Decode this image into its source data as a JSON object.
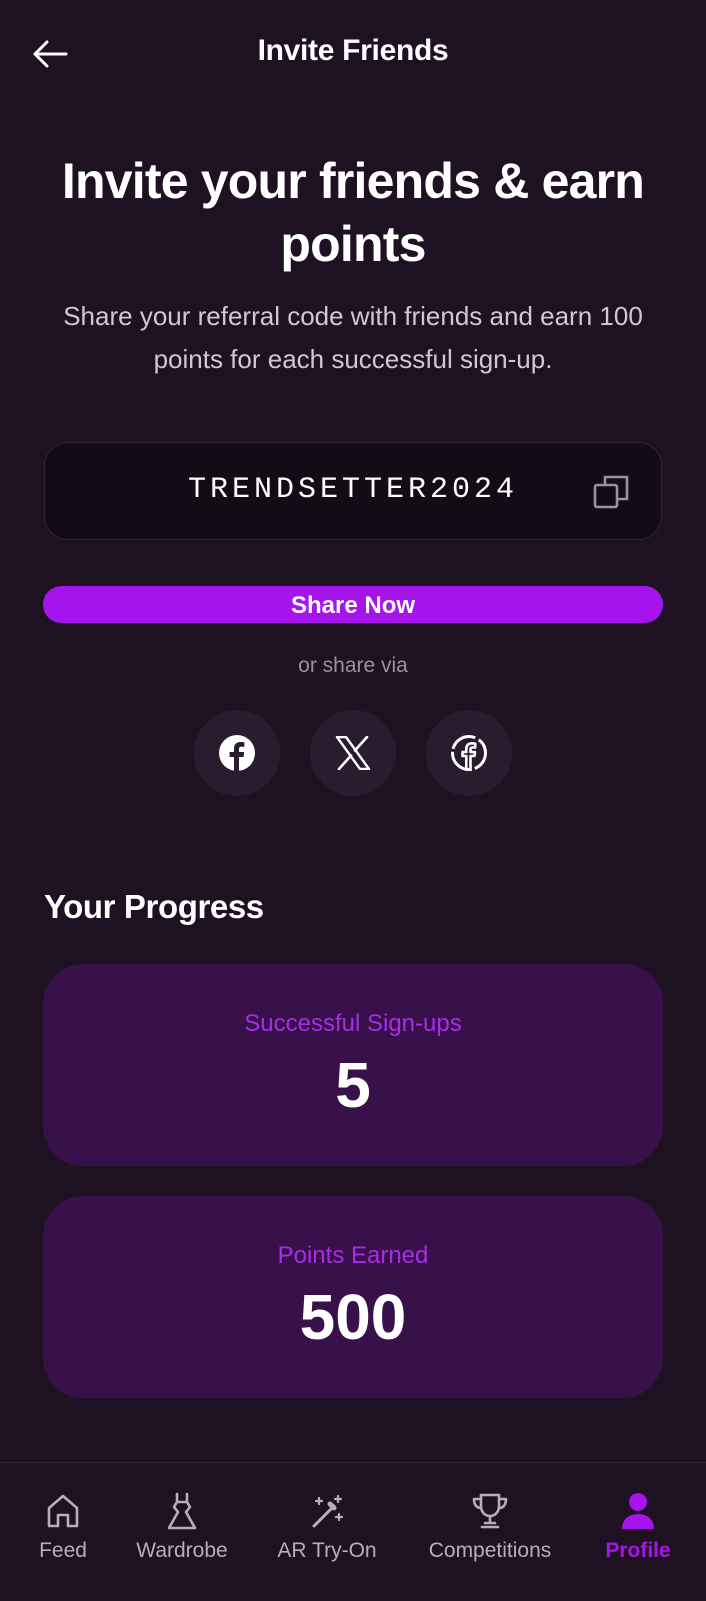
{
  "header": {
    "title": "Invite Friends",
    "back_icon": "arrow-left-icon"
  },
  "hero": {
    "title": "Invite your friends & earn points",
    "subtitle": "Share your referral code with friends and earn 100 points for each successful sign-up."
  },
  "referral": {
    "code": "TRENDSETTER2024",
    "copy_icon": "copy-icon"
  },
  "share": {
    "button_label": "Share Now",
    "or_text": "or share via",
    "networks": [
      {
        "name": "facebook",
        "icon": "facebook-icon"
      },
      {
        "name": "x",
        "icon": "x-logo-icon"
      },
      {
        "name": "facebook-alt",
        "icon": "facebook-outline-icon"
      }
    ]
  },
  "progress": {
    "title": "Your Progress",
    "stats": [
      {
        "label": "Successful Sign-ups",
        "value": "5"
      },
      {
        "label": "Points Earned",
        "value": "500"
      }
    ]
  },
  "nav": {
    "items": [
      {
        "label": "Feed",
        "icon": "home-icon",
        "active": false
      },
      {
        "label": "Wardrobe",
        "icon": "dress-icon",
        "active": false
      },
      {
        "label": "AR Try-On",
        "icon": "magic-wand-icon",
        "active": false
      },
      {
        "label": "Competitions",
        "icon": "trophy-icon",
        "active": false
      },
      {
        "label": "Profile",
        "icon": "person-icon",
        "active": true
      }
    ]
  },
  "colors": {
    "background": "#1e1222",
    "accent": "#a614ec",
    "card": "#38104a",
    "stat_label": "#a92ce8",
    "muted": "#b7aebd"
  }
}
